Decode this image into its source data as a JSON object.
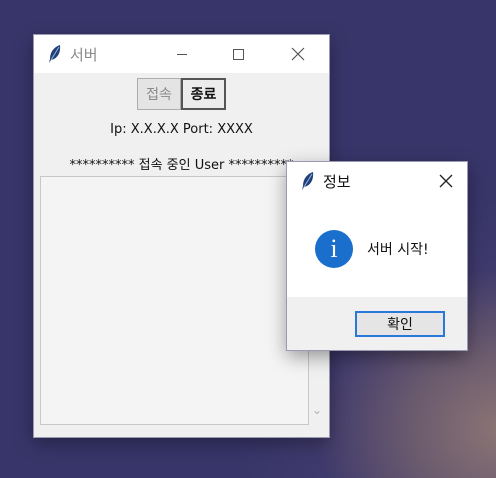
{
  "server_window": {
    "title": "서버",
    "buttons": {
      "connect": "접속",
      "quit": "종료"
    },
    "address_line": "Ip: X.X.X.X  Port: XXXX",
    "user_list_header": "********** 접속 중인 User **********"
  },
  "info_dialog": {
    "title": "정보",
    "icon_glyph": "i",
    "message": "서버 시작!",
    "ok_label": "확인"
  },
  "colors": {
    "accent": "#1a6fcc",
    "focus_border": "#2a79d8"
  }
}
